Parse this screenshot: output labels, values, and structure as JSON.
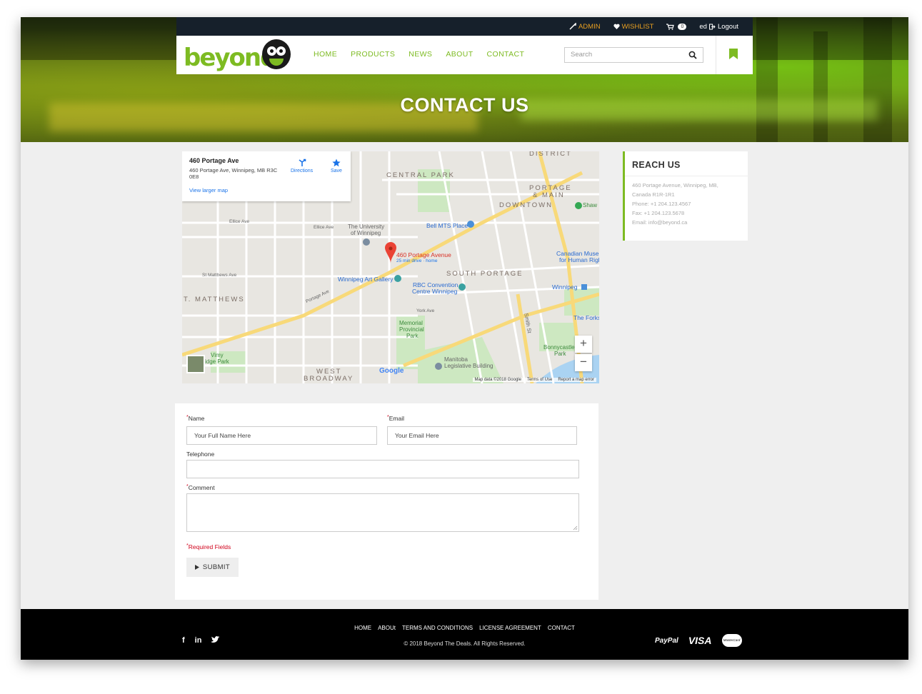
{
  "topbar": {
    "admin": "ADMIN",
    "wishlist": "WISHLIST",
    "cart_count": "0",
    "user": "ed",
    "logout": "Logout"
  },
  "brand": {
    "logo_text": "beyond"
  },
  "nav": {
    "items": [
      "HOME",
      "PRODUCTS",
      "NEWS",
      "ABOUT",
      "CONTACT"
    ],
    "search_placeholder": "Search"
  },
  "hero": {
    "title": "CONTACT US"
  },
  "map": {
    "info_title": "460 Portage Ave",
    "info_address": "460 Portage Ave, Winnipeg, MB R3C 0E8",
    "directions": "Directions",
    "save": "Save",
    "view_larger": "View larger map",
    "pin_label": "460 Portage Avenue",
    "pin_sub": "25 min drive · home",
    "labels": {
      "central_park": "CENTRAL PARK",
      "portage_main": "PORTAGE",
      "portage_main_2": "& MAIN",
      "downtown": "DOWNTOWN",
      "south_portage": "SOUTH PORTAGE",
      "st_matthews": "T. MATTHEWS",
      "west": "WEST",
      "broadway": "BROADWAY",
      "district": "DISTRICT",
      "bell_mts": "Bell MTS Place",
      "u_winnipeg": "The University",
      "u_winnipeg_2": "of Winnipeg",
      "art_gallery": "Winnipeg Art Gallery",
      "rbc": "RBC Convention",
      "rbc_2": "Centre Winnipeg",
      "memorial": "Memorial",
      "memorial_2": "Provincial",
      "memorial_3": "Park",
      "legislative": "Manitoba",
      "legislative_2": "Legislative Building",
      "canadian_museum": "Canadian Museu",
      "canadian_museum_2": "for Human Righ",
      "winnipeg": "Winnipeg",
      "the_forks": "The Forks",
      "bonnycastle": "Bonnycastle",
      "bonnycastle_2": "Park",
      "vimy": "Vimy",
      "vimy_2": "idge Park",
      "shaw": "Shaw I",
      "ellice": "Ellice Ave",
      "ellice_2": "Ellice Ave",
      "st_matthews_ave": "St Matthews Ave",
      "portage_ave": "Portage Ave",
      "york": "York Ave",
      "smith": "Smith St"
    },
    "zoom_in": "+",
    "zoom_out": "−",
    "google": "Google",
    "footer": [
      "Map data ©2018 Google",
      "Terms of Use",
      "Report a map error"
    ]
  },
  "reach": {
    "title": "REACH US",
    "address_1": "460 Portage Avenue, Winnipeg, MB,",
    "address_2": "Canada R1R-1R1",
    "phone": "Phone: +1 204.123.4567",
    "fax": "Fax: +1 204.123.5678",
    "email": "Email: info@beyond.ca"
  },
  "form": {
    "name_label": "Name",
    "name_placeholder": "Your Full Name Here",
    "email_label": "Email",
    "email_placeholder": "Your Email Here",
    "telephone_label": "Telephone",
    "comment_label": "Comment",
    "required_note": "Required Fields",
    "submit": "SUBMIT"
  },
  "footer": {
    "links": [
      "HOME",
      "ABOUt",
      "TERMS AND CONDITIONS",
      "LICENSE AGREEMENT",
      "CONTACT"
    ],
    "copyright": "© 2018 Beyond The Deals. All Rights Reserved.",
    "payments": {
      "paypal": "PayPal",
      "visa": "VISA",
      "mastercard": "MasterCard"
    },
    "social": {
      "facebook": "f",
      "linkedin": "in",
      "twitter": "t"
    }
  },
  "colors": {
    "brand_green": "#7dbb22",
    "topbar_bg": "#16202b",
    "accent_orange": "#e9a021",
    "required_red": "#d0021b"
  }
}
